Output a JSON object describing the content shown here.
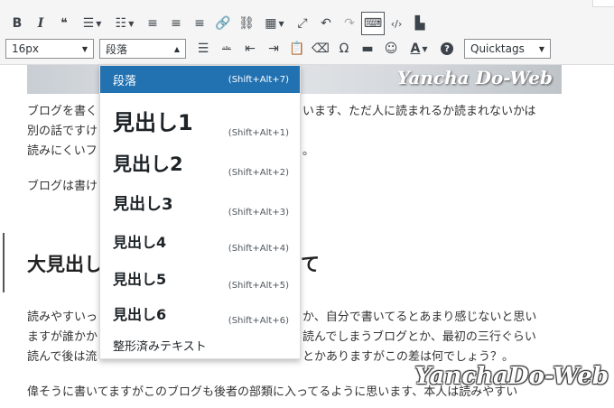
{
  "toolbar": {
    "row1": [
      {
        "name": "bold-icon",
        "glyph": "B"
      },
      {
        "name": "italic-icon",
        "glyph": "I"
      },
      {
        "name": "blockquote-icon",
        "glyph": "❝"
      },
      {
        "name": "bullet-list-icon",
        "glyph": "☰"
      },
      {
        "name": "numbered-list-icon",
        "glyph": "☷"
      },
      {
        "name": "align-left-icon",
        "glyph": "≡"
      },
      {
        "name": "align-center-icon",
        "glyph": "≡"
      },
      {
        "name": "align-right-icon",
        "glyph": "≡"
      },
      {
        "name": "link-icon",
        "glyph": "🔗"
      },
      {
        "name": "unlink-icon",
        "glyph": "⛓"
      },
      {
        "name": "table-icon",
        "glyph": "▦"
      },
      {
        "name": "fullscreen-icon",
        "glyph": "⤢"
      },
      {
        "name": "undo-icon",
        "glyph": "↶"
      },
      {
        "name": "redo-icon",
        "glyph": "↷"
      },
      {
        "name": "keyboard-icon",
        "glyph": "⌨"
      },
      {
        "name": "code-icon",
        "glyph": "‹/›"
      },
      {
        "name": "document-icon",
        "glyph": "▙"
      }
    ],
    "font_size": "16px",
    "format_select": "段落",
    "quicktags": "Quicktags",
    "row2": [
      {
        "name": "justify-icon",
        "glyph": "☰"
      },
      {
        "name": "strikethrough-icon",
        "glyph": "ᴬᴮᶜ"
      },
      {
        "name": "outdent-icon",
        "glyph": "⇤"
      },
      {
        "name": "indent-icon",
        "glyph": "⇥"
      },
      {
        "name": "paste-text-icon",
        "glyph": "📋"
      },
      {
        "name": "clear-format-icon",
        "glyph": "⌫"
      },
      {
        "name": "special-char-icon",
        "glyph": "Ω"
      },
      {
        "name": "horizontal-rule-icon",
        "glyph": "▬"
      },
      {
        "name": "emoji-icon",
        "glyph": "☺"
      },
      {
        "name": "text-color-icon",
        "glyph": "A"
      },
      {
        "name": "help-icon",
        "glyph": "?"
      }
    ]
  },
  "format_menu": {
    "items": [
      {
        "label": "段落",
        "shortcut": "(Shift+Alt+7)",
        "size": 13,
        "bold": false
      },
      {
        "label": "見出し1",
        "shortcut": "(Shift+Alt+1)",
        "size": 24,
        "bold": true
      },
      {
        "label": "見出し2",
        "shortcut": "(Shift+Alt+2)",
        "size": 21,
        "bold": true
      },
      {
        "label": "見出し3",
        "shortcut": "(Shift+Alt+3)",
        "size": 18,
        "bold": true
      },
      {
        "label": "見出し4",
        "shortcut": "(Shift+Alt+4)",
        "size": 16,
        "bold": true
      },
      {
        "label": "見出し5",
        "shortcut": "(Shift+Alt+5)",
        "size": 16,
        "bold": true
      },
      {
        "label": "見出し6",
        "shortcut": "(Shift+Alt+6)",
        "size": 16,
        "bold": true
      },
      {
        "label": "整形済みテキスト",
        "shortcut": "",
        "size": 13,
        "bold": false
      }
    ]
  },
  "content": {
    "watermark": "Yancha Do-Web",
    "watermark_bottom": "YanchaDo-Web",
    "p1_line1": "ブログを書く",
    "p1_line1_right": "います、ただ人に読まれるか読まれないかは",
    "p1_line2": "別の話ですけ",
    "p1_line3": "読みにくいフ",
    "p1_line3_right": "。",
    "p2": "ブログは書け",
    "heading_left": "大見出し",
    "heading_right": "て",
    "p3_line1": "読みやすいっ",
    "p3_line1_right": "か、自分で書いてるとあまり感じないと思い",
    "p3_line2": "ますが誰かか",
    "p3_line2_right": "読んでしまうブログとか、最初の三行ぐらい",
    "p3_line3": "読んで後は流",
    "p3_line3_right": "とかありますがこの差は何でしょう？。",
    "p4": "偉そうに書いてますがこのブログも後者の部類に入ってるように思います、本人は読みやすい"
  }
}
